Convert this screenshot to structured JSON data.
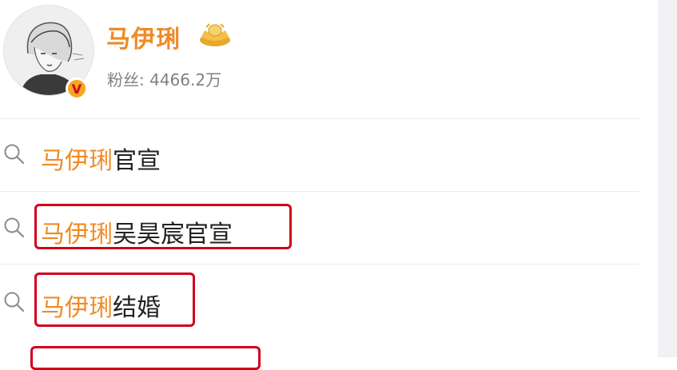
{
  "profile": {
    "name": "马伊琍",
    "followers_label": "粉丝:",
    "followers_count": "4466.2万",
    "verified_mark": "V"
  },
  "suggestions": [
    {
      "keyword": "马伊琍",
      "rest": "官宣",
      "highlighted": false
    },
    {
      "keyword": "马伊琍",
      "rest": "吴昊宸官宣",
      "highlighted": true
    },
    {
      "keyword": "马伊琍",
      "rest": "结婚",
      "highlighted": true
    }
  ],
  "colors": {
    "keyword": "#f08a24",
    "highlight_box": "#d0021b",
    "text": "#222222",
    "muted": "#808080"
  }
}
